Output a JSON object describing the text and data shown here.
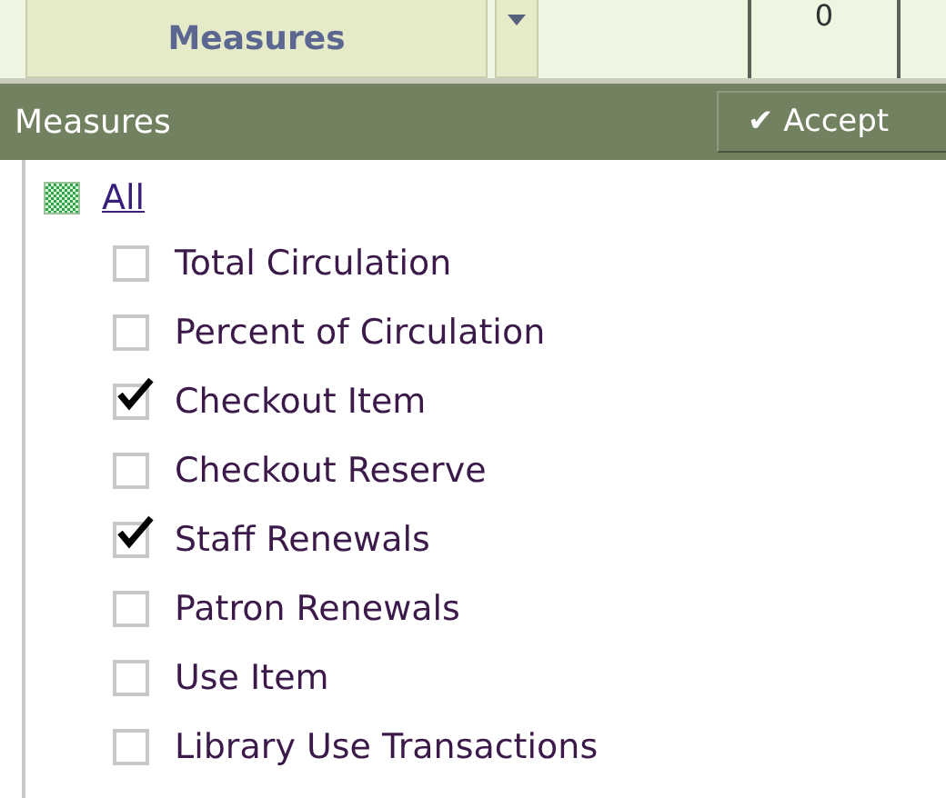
{
  "toolbar": {
    "measures_button": "Measures",
    "cells": [
      "0"
    ]
  },
  "panel": {
    "title": "Measures",
    "accept_button": "✔ Accept",
    "all_link": "All",
    "items": [
      {
        "label": "Total Circulation",
        "checked": false
      },
      {
        "label": "Percent of Circulation",
        "checked": false
      },
      {
        "label": "Checkout Item",
        "checked": true
      },
      {
        "label": "Checkout Reserve",
        "checked": false
      },
      {
        "label": "Staff Renewals",
        "checked": true
      },
      {
        "label": "Patron Renewals",
        "checked": false
      },
      {
        "label": "Use Item",
        "checked": false
      },
      {
        "label": "Library Use Transactions",
        "checked": false
      }
    ]
  }
}
